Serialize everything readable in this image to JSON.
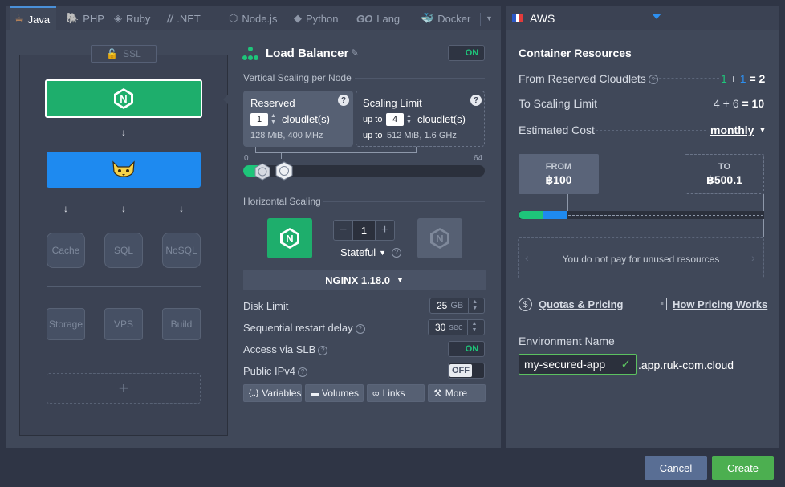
{
  "tabs": [
    {
      "label": "Java",
      "icon": "java-icon",
      "active": true
    },
    {
      "label": "PHP",
      "icon": "php-icon"
    },
    {
      "label": "Ruby",
      "icon": "ruby-icon"
    },
    {
      "label": ".NET",
      "icon": "dotnet-icon"
    },
    {
      "label": "Node.js",
      "icon": "nodejs-icon"
    },
    {
      "label": "Python",
      "icon": "python-icon"
    },
    {
      "label": "Lang",
      "icon": "go-icon",
      "prefix": "GO"
    },
    {
      "label": "Docker",
      "icon": "docker-icon"
    }
  ],
  "region": {
    "label": "AWS",
    "flag": "france-flag"
  },
  "topology": {
    "ssl_label": "SSL",
    "balancer_letter": "N",
    "stack_row": [
      "Cache",
      "SQL",
      "NoSQL"
    ],
    "extra_row": [
      "Storage",
      "VPS",
      "Build"
    ],
    "add_symbol": "+"
  },
  "config": {
    "title": "Load Balancer",
    "title_toggle": "ON",
    "vertical_title": "Vertical Scaling per Node",
    "reserved": {
      "title": "Reserved",
      "value": "1",
      "unit": "cloudlet(s)",
      "info": "128 MiB, 400 MHz"
    },
    "limit": {
      "title": "Scaling Limit",
      "prefix": "up to",
      "value": "4",
      "unit": "cloudlet(s)",
      "info_prefix": "up to",
      "info": "512 MiB, 1.6 GHz"
    },
    "slider": {
      "min": "0",
      "max": "64",
      "reserved": 1,
      "limit": 4
    },
    "horizontal_title": "Horizontal Scaling",
    "node_count": "1",
    "node_letter": "N",
    "stateful_label": "Stateful",
    "version": "NGINX 1.18.0",
    "disk_limit": {
      "label": "Disk Limit",
      "value": "25",
      "unit": "GB"
    },
    "restart_delay": {
      "label": "Sequential restart delay",
      "value": "30",
      "unit": "sec"
    },
    "slb": {
      "label": "Access via SLB",
      "state": "ON"
    },
    "ipv4": {
      "label": "Public IPv4",
      "state": "OFF"
    },
    "buttons": [
      {
        "label": "Variables",
        "icon": "variables-icon",
        "glyph": "{..}"
      },
      {
        "label": "Volumes",
        "icon": "folder-icon",
        "glyph": "▬"
      },
      {
        "label": "Links",
        "icon": "link-icon",
        "glyph": "∞"
      },
      {
        "label": "More",
        "icon": "wrench-icon",
        "glyph": "⚒"
      }
    ]
  },
  "resources": {
    "title": "Container Resources",
    "reserved": {
      "label": "From Reserved Cloudlets",
      "a": "1",
      "b": "1",
      "total": "2",
      "a_color": "#1ec57a",
      "b_color": "#2d8ff0"
    },
    "scaling": {
      "label": "To Scaling Limit",
      "a": "4",
      "b": "6",
      "total": "10"
    },
    "cost": {
      "label": "Estimated Cost",
      "period": "monthly"
    },
    "from": {
      "label": "FROM",
      "value": "฿100"
    },
    "to": {
      "label": "TO",
      "value": "฿500.1"
    },
    "unused_note": "You do not pay for unused resources",
    "quotas_label": "Quotas & Pricing",
    "pricing_label": "How Pricing Works",
    "env_label": "Environment Name",
    "env_value": "my-secured-app",
    "domain_suffix": ".app.ruk-com.cloud"
  },
  "footer": {
    "cancel": "Cancel",
    "create": "Create"
  },
  "colors": {
    "green": "#1eae6c",
    "blue": "#1e8af0",
    "create": "#4caf50",
    "cancel": "#596e94"
  }
}
